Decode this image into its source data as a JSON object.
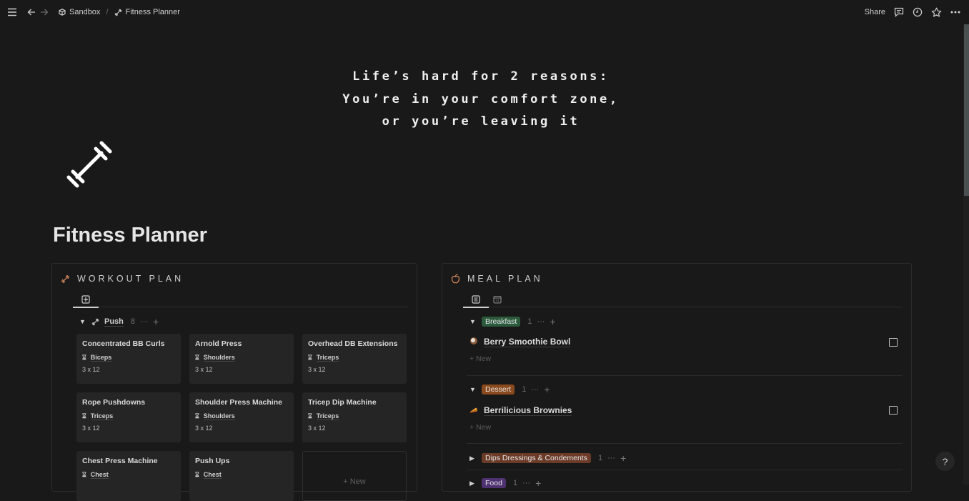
{
  "topbar": {
    "breadcrumb": [
      {
        "label": "Sandbox",
        "icon": "cube-icon"
      },
      {
        "label": "Fitness Planner",
        "icon": "dumbbell-icon"
      }
    ],
    "separator": "/",
    "share_label": "Share"
  },
  "cover": {
    "quote_lines": [
      "Life’s hard for 2 reasons:",
      "You’re in your comfort zone,",
      "or you’re leaving it"
    ]
  },
  "page": {
    "title": "Fitness Planner",
    "icon": "dumbbell-icon"
  },
  "workout": {
    "heading": "WORKOUT PLAN",
    "group": {
      "label": "Push",
      "count": "8"
    },
    "cards": [
      {
        "name": "Concentrated BB Curls",
        "muscle": "Biceps",
        "sets": "3 x 12"
      },
      {
        "name": "Arnold Press",
        "muscle": "Shoulders",
        "sets": "3 x 12"
      },
      {
        "name": "Overhead DB Extensions",
        "muscle": "Triceps",
        "sets": "3 x 12"
      },
      {
        "name": "Rope Pushdowns",
        "muscle": "Triceps",
        "sets": "3 x 12"
      },
      {
        "name": "Shoulder Press Machine",
        "muscle": "Shoulders",
        "sets": "3 x 12"
      },
      {
        "name": "Tricep Dip Machine",
        "muscle": "Triceps",
        "sets": "3 x 12"
      },
      {
        "name": "Chest Press Machine",
        "muscle": "Chest",
        "sets": ""
      },
      {
        "name": "Push Ups",
        "muscle": "Chest",
        "sets": ""
      }
    ],
    "new_label": "+ New"
  },
  "meal": {
    "heading": "MEAL PLAN",
    "groups": [
      {
        "label": "Breakfast",
        "count": "1",
        "color": "#2b5a3c",
        "expanded": true,
        "item": "Berry Smoothie Bowl",
        "item_icon": "coconut-icon"
      },
      {
        "label": "Dessert",
        "count": "1",
        "color": "#8a4a1e",
        "expanded": true,
        "item": "Berrilicious Brownies",
        "item_icon": "pie-icon"
      },
      {
        "label": "Dips Dressings & Condements",
        "count": "1",
        "color": "#6b3b28",
        "expanded": false
      },
      {
        "label": "Food",
        "count": "1",
        "color": "#4e3170",
        "expanded": false
      }
    ],
    "new_label": "+ New"
  },
  "help": {
    "label": "?"
  }
}
